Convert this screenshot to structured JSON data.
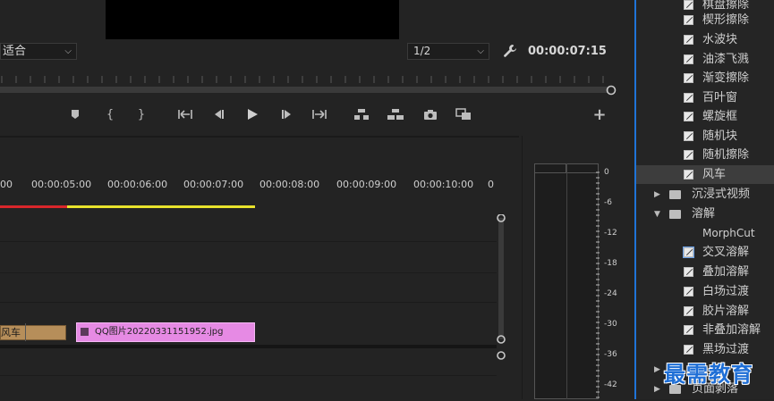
{
  "monitor": {
    "zoom_value": "适合",
    "resolution_value": "1/2",
    "timecode": "00:00:07:15",
    "transport_icons": [
      "add-marker-icon",
      "mark-in-icon",
      "mark-out-icon",
      "go-to-in-icon",
      "step-back-icon",
      "play-icon",
      "step-forward-icon",
      "go-to-out-icon",
      "lift-icon",
      "extract-icon",
      "export-frame-icon",
      "comparison-view-icon",
      "add-button-icon"
    ]
  },
  "timeline": {
    "ruler_labels": [
      "00",
      "00:00:05:00",
      "00:00:06:00",
      "00:00:07:00",
      "00:00:08:00",
      "00:00:09:00",
      "00:00:10:00",
      "0"
    ],
    "clip_a_label": "风车",
    "clip_b_label": "QQ图片20220331151952.jpg"
  },
  "meters": {
    "db_labels": [
      "0",
      "-6",
      "-12",
      "-18",
      "-24",
      "-30",
      "-36",
      "-42"
    ]
  },
  "effects": {
    "items": [
      {
        "label": "棋盘擦除"
      },
      {
        "label": "楔形擦除"
      },
      {
        "label": "水波块"
      },
      {
        "label": "油漆飞溅"
      },
      {
        "label": "渐变擦除"
      },
      {
        "label": "百叶窗"
      },
      {
        "label": "螺旋框"
      },
      {
        "label": "随机块"
      },
      {
        "label": "随机擦除"
      },
      {
        "label": "风车"
      }
    ],
    "folder_immersive": "沉浸式视频",
    "folder_dissolve": "溶解",
    "dissolve_items": [
      {
        "label": "MorphCut"
      },
      {
        "label": "交叉溶解"
      },
      {
        "label": "叠加溶解"
      },
      {
        "label": "白场过渡"
      },
      {
        "label": "胶片溶解"
      },
      {
        "label": "非叠加溶解"
      },
      {
        "label": "黑场过渡"
      }
    ],
    "folder_page_peel": "页面剥落"
  },
  "watermark": "最需教育",
  "colors": {
    "accent_blue": "#1f74d8",
    "clip_pink": "#e68ae4",
    "clip_tan": "#b68e5a",
    "work_area_yellow": "#e8e22c",
    "work_area_red": "#d9262b"
  }
}
